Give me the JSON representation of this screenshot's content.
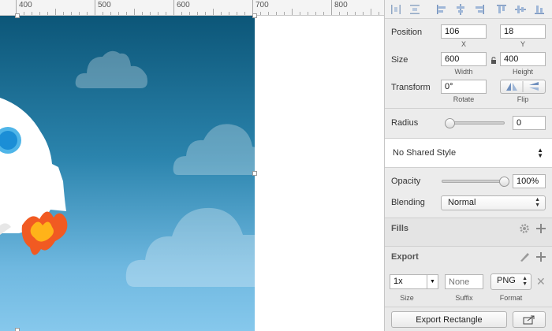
{
  "ruler": {
    "labels": [
      "400",
      "500",
      "600",
      "700",
      "800"
    ]
  },
  "inspector": {
    "position": {
      "label": "Position",
      "x": "106",
      "y": "18",
      "x_caption": "X",
      "y_caption": "Y"
    },
    "size": {
      "label": "Size",
      "width": "600",
      "height": "400",
      "width_caption": "Width",
      "height_caption": "Height"
    },
    "transform": {
      "label": "Transform",
      "rotate": "0°",
      "rotate_caption": "Rotate",
      "flip_caption": "Flip"
    },
    "radius": {
      "label": "Radius",
      "value": "0",
      "level": 0
    },
    "shared_style": {
      "value": "No Shared Style"
    },
    "opacity": {
      "label": "Opacity",
      "value": "100%",
      "level": 1.0
    },
    "blending": {
      "label": "Blending",
      "value": "Normal"
    },
    "fills": {
      "title": "Fills"
    },
    "export": {
      "title": "Export",
      "scale": "1x",
      "suffix_placeholder": "None",
      "format": "PNG",
      "size_caption": "Size",
      "suffix_caption": "Suffix",
      "format_caption": "Format",
      "button_label": "Export Rectangle"
    }
  },
  "colors": {
    "sky_top": "#0c5678",
    "sky_bottom": "#86c8ec",
    "flame_orange": "#f15a22",
    "flame_yellow": "#ffb319"
  }
}
